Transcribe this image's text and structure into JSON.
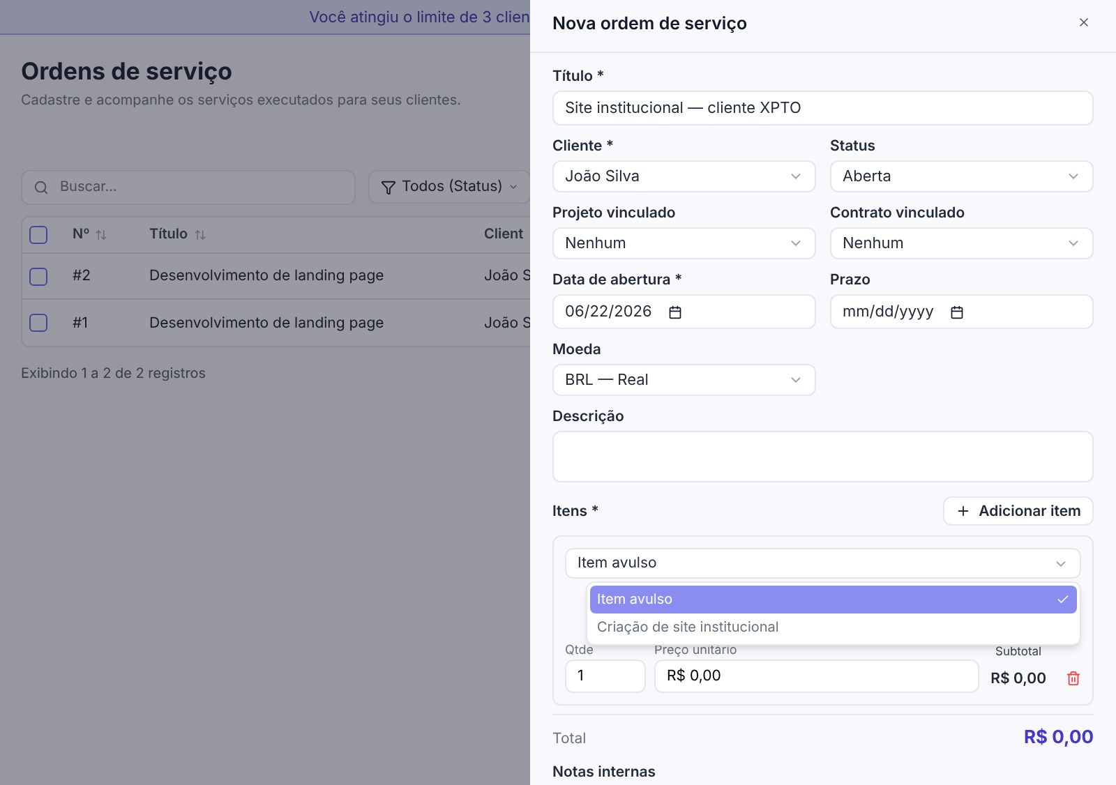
{
  "banner": {
    "text": "Você atingiu o limite de 3 clien"
  },
  "page": {
    "title": "Ordens de serviço",
    "subtitle": "Cadastre e acompanhe os serviços executados para seus clientes."
  },
  "search": {
    "placeholder": "Buscar..."
  },
  "status_filter": {
    "label": "Todos (Status)"
  },
  "table": {
    "header_checked": false,
    "columns": [
      {
        "label": "Nº",
        "kind": "sortable"
      },
      {
        "label": "Título",
        "kind": "sortable"
      },
      {
        "label": "Client",
        "kind": "plain"
      }
    ],
    "rows": [
      {
        "checked": false,
        "number": "#2",
        "title": "Desenvolvimento de landing page",
        "client": "João S"
      },
      {
        "checked": false,
        "number": "#1",
        "title": "Desenvolvimento de landing page",
        "client": "João S"
      }
    ],
    "footer": "Exibindo 1 a 2 de 2 registros"
  },
  "drawer": {
    "title": "Nova ordem de serviço",
    "fields": [
      {
        "label": "Título *",
        "kind": "text",
        "value": "Site institucional — cliente XPTO"
      },
      {
        "label": "Cliente *",
        "kind": "select",
        "value": "João Silva"
      },
      {
        "label": "Status",
        "kind": "select",
        "value": "Aberta"
      },
      {
        "label": "Projeto vinculado",
        "kind": "select",
        "value": "Nenhum"
      },
      {
        "label": "Contrato vinculado",
        "kind": "select",
        "value": "Nenhum"
      },
      {
        "label": "Data de abertura *",
        "kind": "date",
        "value": "06/22/2026"
      },
      {
        "label": "Prazo",
        "kind": "date",
        "placeholder": "mm/dd/yyyy"
      },
      {
        "label": "Moeda",
        "kind": "select",
        "value": "BRL — Real"
      },
      {
        "label": "Descrição",
        "kind": "textarea"
      }
    ],
    "items": {
      "label": "Itens *",
      "add_button": "Adicionar item",
      "entries": [
        {
          "product": "Item avulso",
          "menu": [
            {
              "label": "Item avulso",
              "selected": true
            },
            {
              "label": "Criação de site institucional",
              "selected": false
            }
          ],
          "qty_label": "Qtde",
          "qty": "1",
          "price_label": "Preço unitário",
          "price": "R$ 0,00",
          "subtotal_label": "Subtotal",
          "subtotal": "R$ 0,00"
        }
      ]
    },
    "total": {
      "label": "Total",
      "value": "R$ 0,00"
    },
    "notes_label": "Notas internas"
  }
}
